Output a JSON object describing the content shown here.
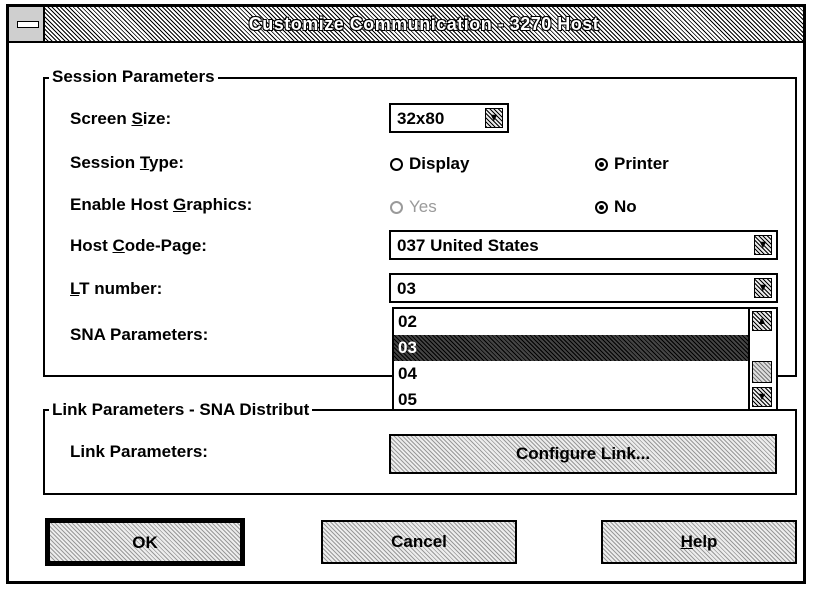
{
  "window": {
    "title": "Customize Communication - 3270 Host"
  },
  "session": {
    "legend": "Session Parameters",
    "screen_size": {
      "label_pre": "Screen ",
      "label_key": "S",
      "label_post": "ize:",
      "value": "32x80"
    },
    "session_type": {
      "label_pre": "Session ",
      "label_key": "T",
      "label_post": "ype:",
      "options": [
        "Display",
        "Printer"
      ],
      "selected": "Printer"
    },
    "host_graphics": {
      "label_pre": "Enable Host ",
      "label_key": "G",
      "label_post": "raphics:",
      "options": [
        "Yes",
        "No"
      ],
      "selected": "No"
    },
    "code_page": {
      "label_pre": "Host ",
      "label_key": "C",
      "label_post": "ode-Page:",
      "value": "037 United States"
    },
    "lt_number": {
      "label_pre": "",
      "label_key": "L",
      "label_post": "T number:",
      "value": "03",
      "list": [
        "02",
        "03",
        "04",
        "05"
      ],
      "selected": "03"
    },
    "sna_label": "SNA Parameters:"
  },
  "link": {
    "legend_visible": "Link Parameters - SNA Distribut",
    "label": "Link Parameters:",
    "configure_button": "Configure Link..."
  },
  "buttons": {
    "ok": "OK",
    "cancel": "Cancel",
    "help_key": "H",
    "help_rest": "elp"
  },
  "icons": {
    "dropdown": "down-arrow-icon",
    "scroll_up": "up-arrow-icon",
    "scroll_down": "down-arrow-icon"
  }
}
